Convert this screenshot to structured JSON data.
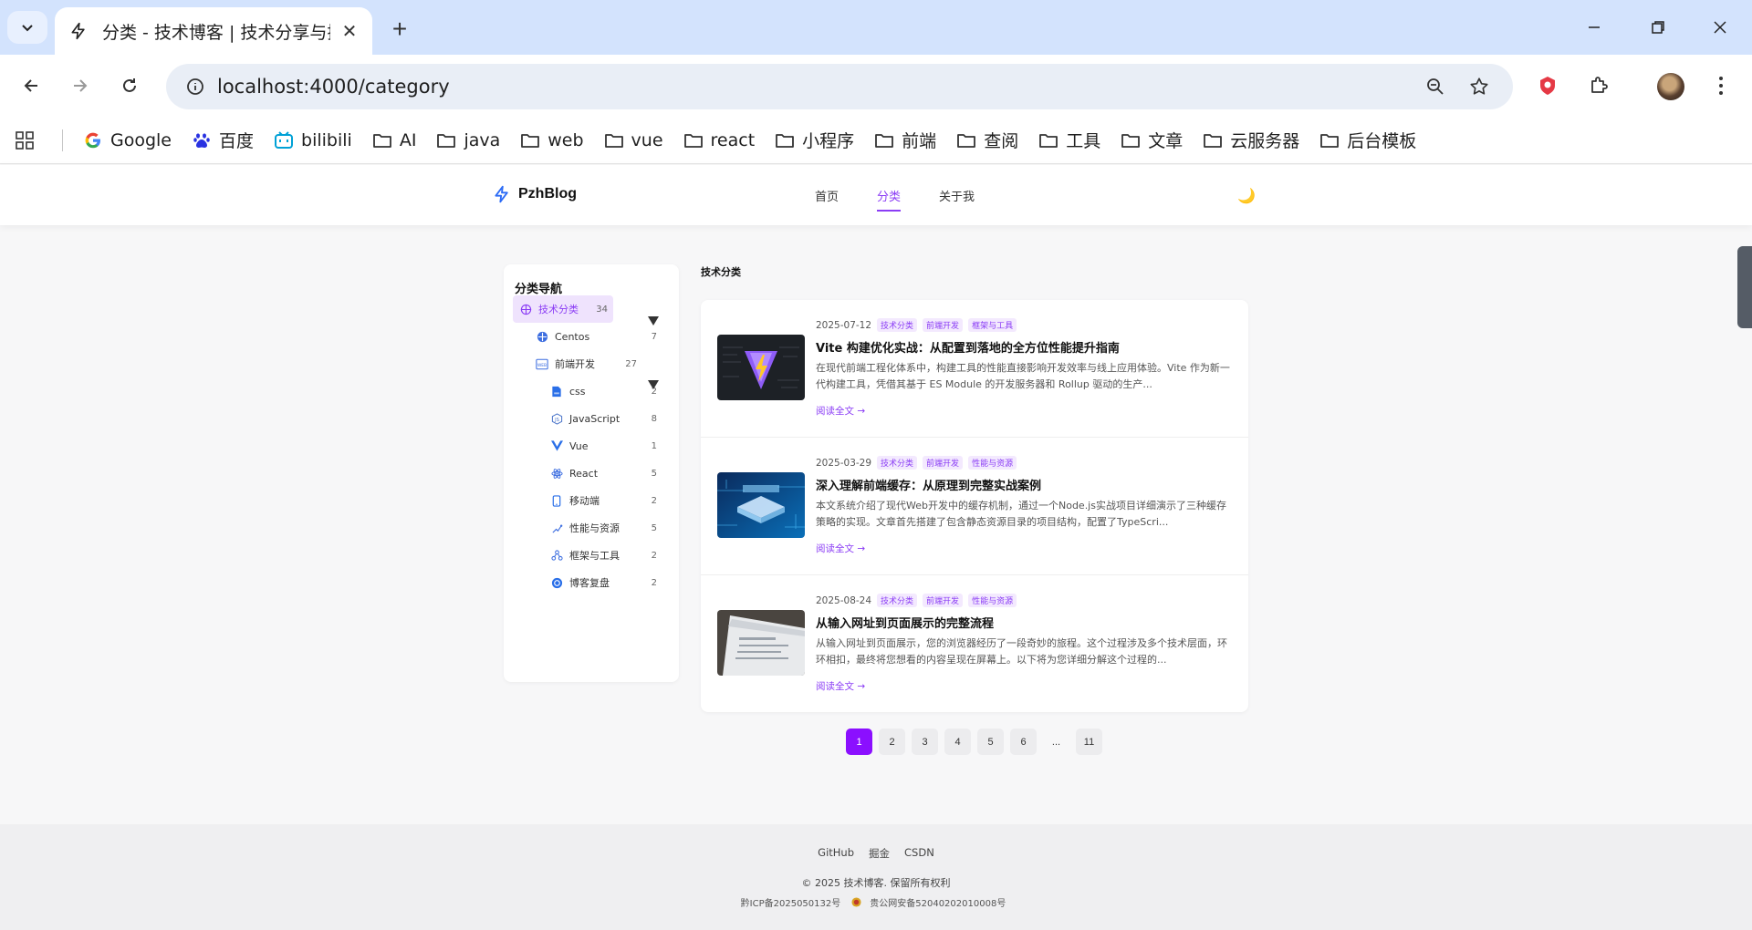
{
  "browser": {
    "tab_title": "分类 - 技术博客 | 技术分享与探索",
    "url": "localhost:4000/category",
    "bookmarks": [
      {
        "label": "Google",
        "icon": "google-icon"
      },
      {
        "label": "百度",
        "icon": "baidu-icon"
      },
      {
        "label": "bilibili",
        "icon": "bilibili-icon"
      },
      {
        "label": "AI",
        "icon": "folder-icon"
      },
      {
        "label": "java",
        "icon": "folder-icon"
      },
      {
        "label": "web",
        "icon": "folder-icon"
      },
      {
        "label": "vue",
        "icon": "folder-icon"
      },
      {
        "label": "react",
        "icon": "folder-icon"
      },
      {
        "label": "小程序",
        "icon": "folder-icon"
      },
      {
        "label": "前端",
        "icon": "folder-icon"
      },
      {
        "label": "查阅",
        "icon": "folder-icon"
      },
      {
        "label": "工具",
        "icon": "folder-icon"
      },
      {
        "label": "文章",
        "icon": "folder-icon"
      },
      {
        "label": "云服务器",
        "icon": "folder-icon"
      },
      {
        "label": "后台模板",
        "icon": "folder-icon"
      }
    ]
  },
  "header": {
    "logo": "PzhBlog",
    "nav": [
      "首页",
      "分类",
      "关于我"
    ],
    "theme_icon": "🌙"
  },
  "sidebar": {
    "title": "分类导航",
    "categories": [
      {
        "label": "技术分类",
        "count": "34",
        "icon": "category-icon"
      },
      {
        "label": "Centos",
        "count": "7",
        "icon": "centos-icon"
      },
      {
        "label": "前端开发",
        "count": "27",
        "icon": "web-icon"
      },
      {
        "label": "css",
        "count": "2",
        "icon": "css-icon"
      },
      {
        "label": "JavaScript",
        "count": "8",
        "icon": "javascript-icon"
      },
      {
        "label": "Vue",
        "count": "1",
        "icon": "vue-icon"
      },
      {
        "label": "React",
        "count": "5",
        "icon": "react-icon"
      },
      {
        "label": "移动端",
        "count": "2",
        "icon": "mobile-icon"
      },
      {
        "label": "性能与资源",
        "count": "5",
        "icon": "performance-icon"
      },
      {
        "label": "框架与工具",
        "count": "2",
        "icon": "tools-icon"
      },
      {
        "label": "博客复盘",
        "count": "2",
        "icon": "review-icon"
      }
    ]
  },
  "main": {
    "section_title": "技术分类",
    "posts": [
      {
        "date": "2025-07-12",
        "tags": [
          "技术分类",
          "前端开发",
          "框架与工具"
        ],
        "title": "Vite 构建优化实战：从配置到落地的全方位性能提升指南",
        "excerpt": "在现代前端工程化体系中，构建工具的性能直接影响开发效率与线上应用体验。Vite 作为新一代构建工具，凭借其基于 ES Module 的开发服务器和 Rollup 驱动的生产...",
        "read_more": "阅读全文 →"
      },
      {
        "date": "2025-03-29",
        "tags": [
          "技术分类",
          "前端开发",
          "性能与资源"
        ],
        "title": "深入理解前端缓存：从原理到完整实战案例",
        "excerpt": "本文系统介绍了现代Web开发中的缓存机制，通过一个Node.js实战项目详细演示了三种缓存策略的实现。文章首先搭建了包含静态资源目录的项目结构，配置了TypeScri...",
        "read_more": "阅读全文 →"
      },
      {
        "date": "2025-08-24",
        "tags": [
          "技术分类",
          "前端开发",
          "性能与资源"
        ],
        "title": "从输入网址到页面展示的完整流程",
        "excerpt": "从输入网址到页面展示，您的浏览器经历了一段奇妙的旅程。这个过程涉及多个技术层面，环环相扣，最终将您想看的内容呈现在屏幕上。以下将为您详细分解这个过程的...",
        "read_more": "阅读全文 →"
      }
    ],
    "pagination": [
      "1",
      "2",
      "3",
      "4",
      "5",
      "6",
      "...",
      "11"
    ],
    "current_page": "1"
  },
  "footer": {
    "links": [
      "GitHub",
      "掘金",
      "CSDN"
    ],
    "copyright": "© 2025 技术博客. 保留所有权利",
    "icp": "黔ICP备2025050132号",
    "police": "贵公网安备52040202010008号"
  },
  "colors": {
    "accent": "#8b3df5",
    "active_page": "#8b0fff",
    "tab_strip": "#d3e3fd"
  }
}
